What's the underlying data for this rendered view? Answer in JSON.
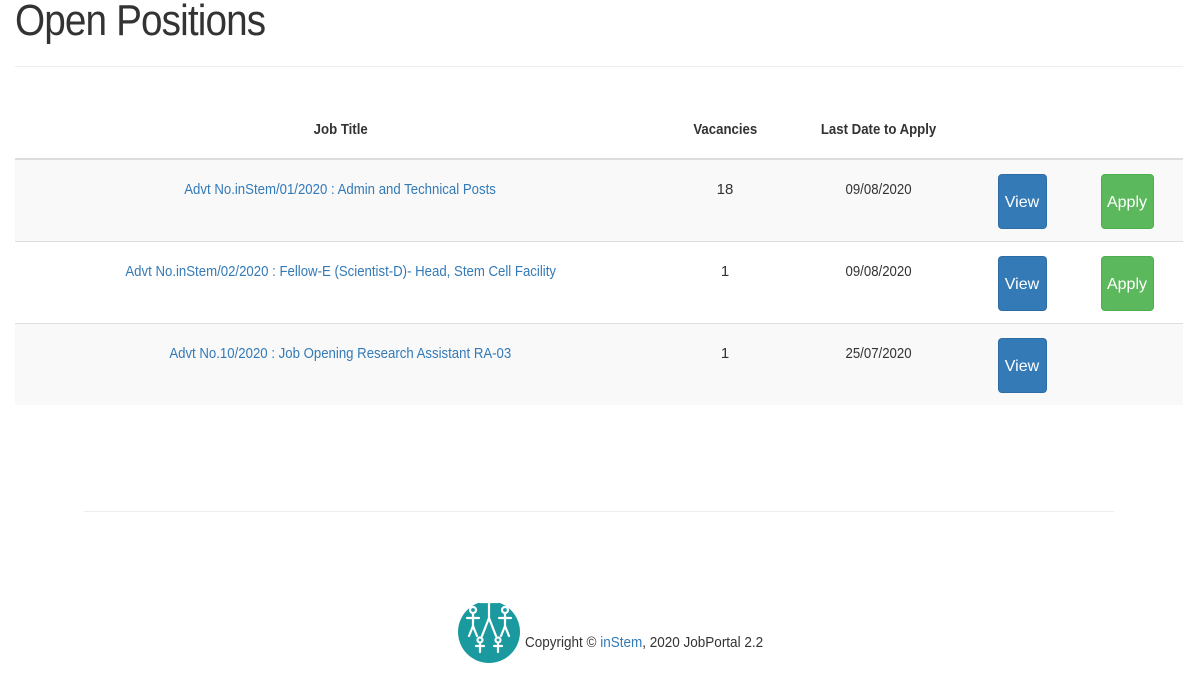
{
  "page": {
    "title": "Open Positions"
  },
  "table": {
    "headers": {
      "job_title": "Job Title",
      "vacancies": "Vacancies",
      "last_date": "Last Date to Apply"
    },
    "rows": [
      {
        "job_title": "Advt No.inStem/01/2020 : Admin and Technical Posts",
        "vacancies": "18",
        "last_date": "09/08/2020",
        "view_label": "View",
        "apply_label": "Apply"
      },
      {
        "job_title": "Advt No.inStem/02/2020 : Fellow-E (Scientist-D)- Head, Stem Cell Facility",
        "vacancies": "1",
        "last_date": "09/08/2020",
        "view_label": "View",
        "apply_label": "Apply"
      },
      {
        "job_title": "Advt No.10/2020 : Job Opening Research Assistant RA-03",
        "vacancies": "1",
        "last_date": "25/07/2020",
        "view_label": "View"
      }
    ]
  },
  "footer": {
    "copyright_prefix": "Copyright © ",
    "org_link": "inStem",
    "copyright_suffix": ", 2020 JobPortal 2.2",
    "logo_icon": "instem-logo-icon"
  },
  "colors": {
    "link": "#337ab7",
    "view_button": "#337ab7",
    "apply_button": "#5cb85c",
    "logo": "#1a9a9e"
  }
}
